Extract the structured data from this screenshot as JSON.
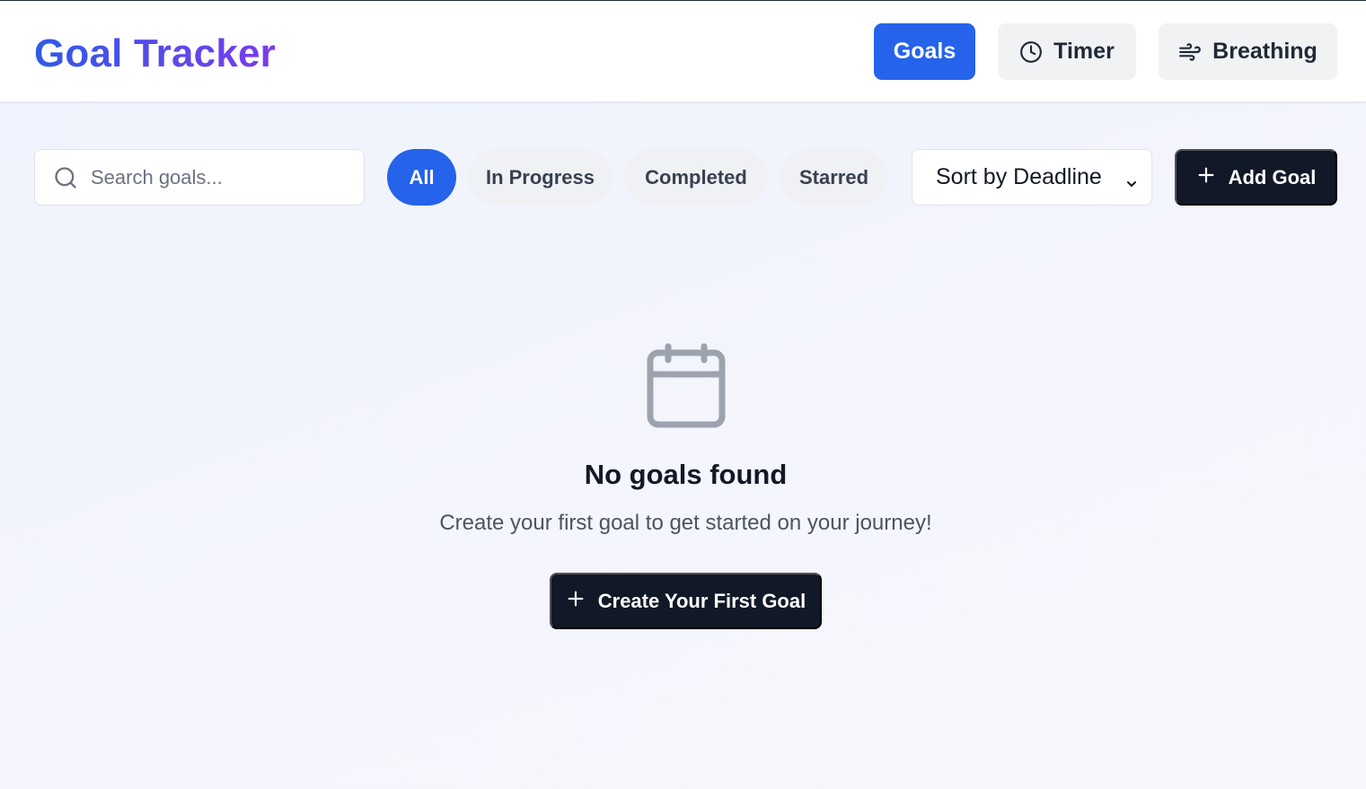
{
  "header": {
    "title": "Goal Tracker",
    "nav": {
      "goals": "Goals",
      "timer": "Timer",
      "breathing": "Breathing"
    }
  },
  "toolbar": {
    "search_placeholder": "Search goals...",
    "filters": [
      "All",
      "In Progress",
      "Completed",
      "Starred"
    ],
    "active_filter": "All",
    "sort_value": "Sort by Deadline",
    "add_label": "Add Goal"
  },
  "empty_state": {
    "icon": "calendar-icon",
    "title": "No goals found",
    "subtitle": "Create your first goal to get started on your journey!",
    "cta_label": "Create Your First Goal"
  },
  "colors": {
    "primary": "#2563eb",
    "dark": "#111827",
    "brand_gradient_start": "#2f5be7",
    "brand_gradient_end": "#7c3aed",
    "muted_icon": "#9ca3af"
  }
}
